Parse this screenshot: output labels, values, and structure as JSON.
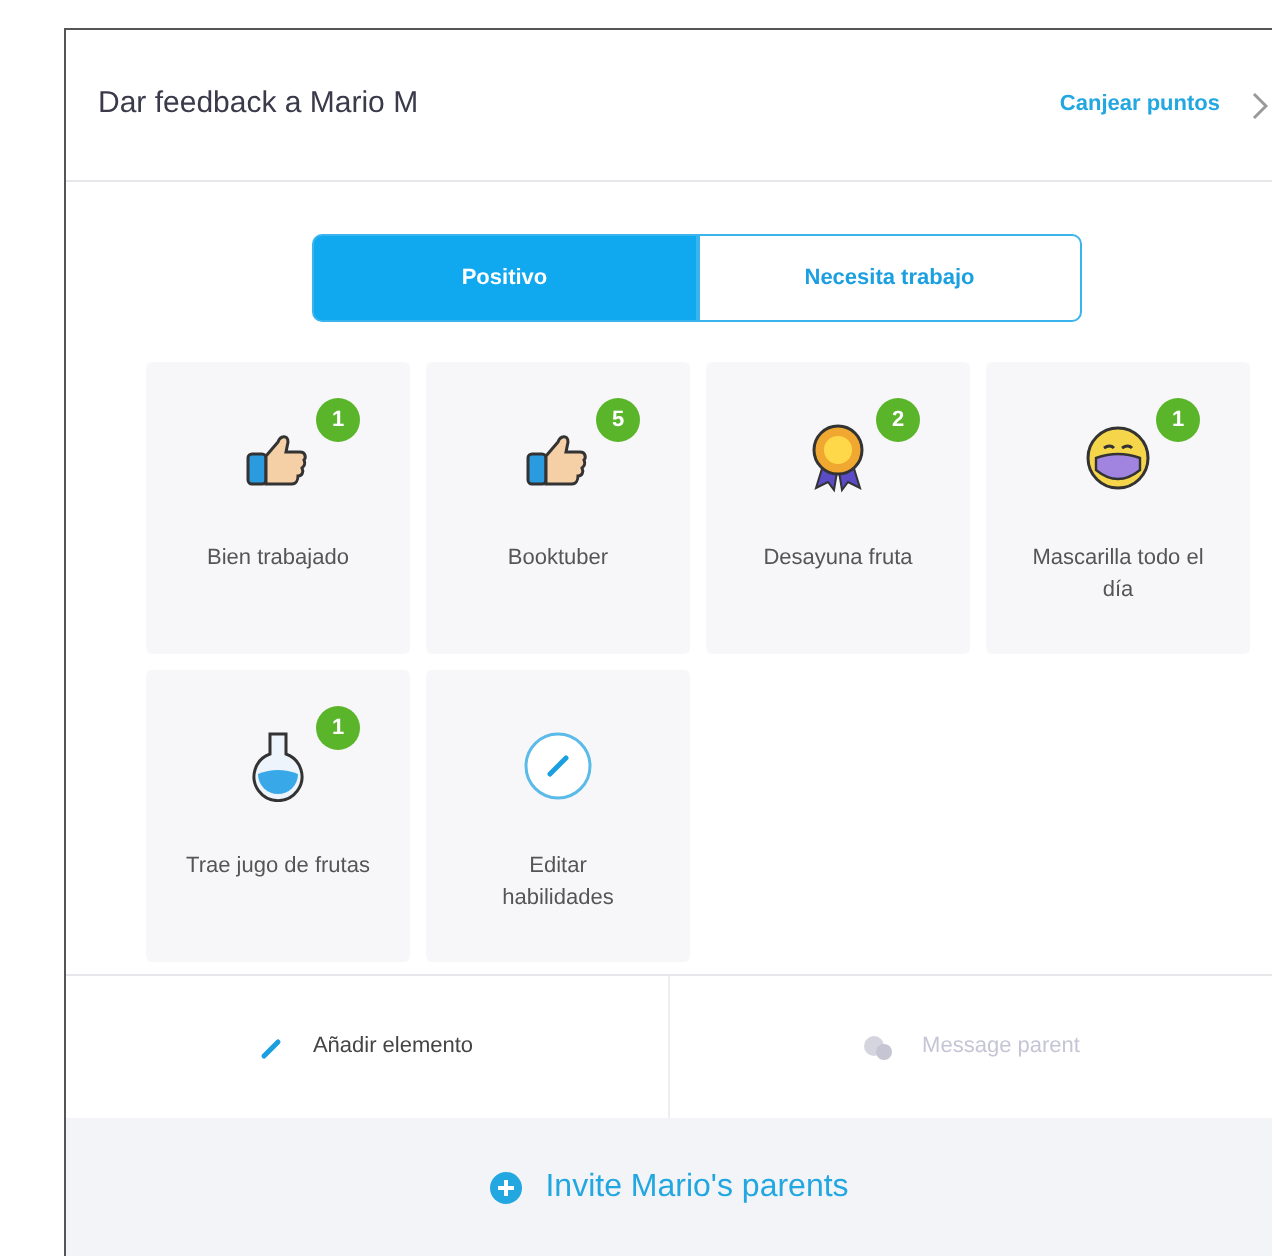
{
  "header": {
    "title": "Dar feedback a Mario M",
    "link": "Canjear puntos"
  },
  "tabs": [
    {
      "label": "Positivo",
      "selected": true
    },
    {
      "label": "Necesita trabajo",
      "selected": false
    }
  ],
  "skills": [
    {
      "kind": "skill",
      "label": "Bien trabajado",
      "count": "1"
    },
    {
      "kind": "skill",
      "label": "Booktuber",
      "count": "5"
    },
    {
      "kind": "skill",
      "label": "Desayuna fruta",
      "count": "2"
    },
    {
      "kind": "skill",
      "label": "Mascarilla todo el día",
      "count": "1"
    },
    {
      "kind": "skill",
      "label": "Trae jugo de frutas",
      "count": "1"
    },
    {
      "kind": "edit",
      "label": "Editar habilidades"
    }
  ],
  "actions": [
    {
      "label": "Añadir elemento",
      "disabled": false
    },
    {
      "label": "Message parent",
      "disabled": true
    }
  ],
  "invite": {
    "label": "Invite Mario's parents"
  }
}
